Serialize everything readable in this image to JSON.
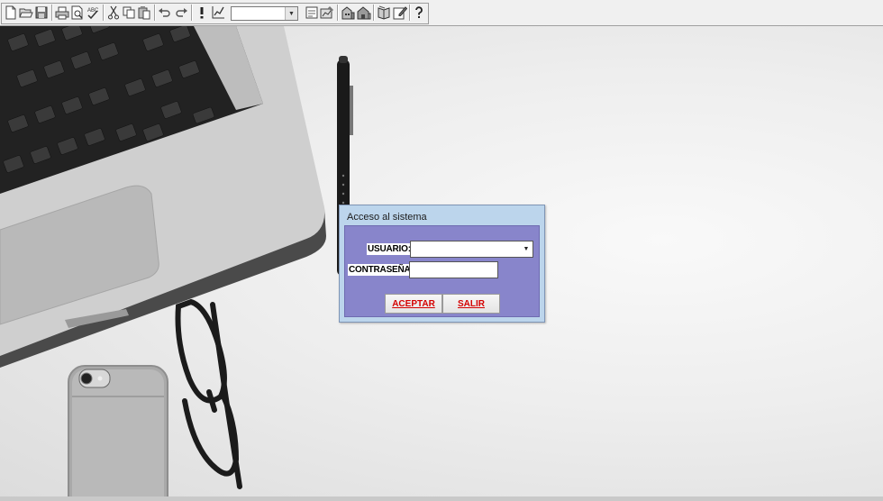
{
  "toolbar": {
    "icons": [
      "new-icon",
      "open-icon",
      "save-icon",
      "print-icon",
      "print-preview-icon",
      "spell-check-icon",
      "cut-icon",
      "copy-icon",
      "paste-icon",
      "undo-icon",
      "redo-icon",
      "exclamation-icon",
      "chart-icon",
      "report-icon",
      "chart-edit-icon",
      "building-icon",
      "building-alt-icon",
      "book-icon",
      "edit-icon",
      "help-icon"
    ],
    "combo_value": ""
  },
  "dialog": {
    "title": "Acceso al sistema",
    "user_label": "USUARIO:",
    "user_value": "",
    "password_label": "CONTRASEÑA:",
    "password_value": "",
    "accept_label": "ACEPTAR",
    "exit_label": "SALIR"
  },
  "colors": {
    "dialog_frame": "#bcd5ec",
    "dialog_body": "#8885cb",
    "button_text": "#d40000"
  }
}
